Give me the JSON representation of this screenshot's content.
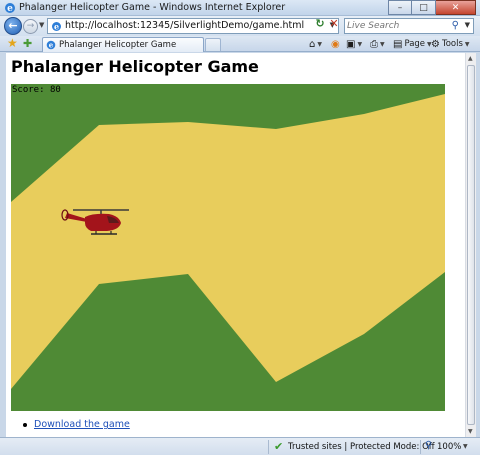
{
  "window": {
    "title": "Phalanger Helicopter Game - Windows Internet Explorer",
    "minimize_glyph": "–",
    "maximize_glyph": "□",
    "close_glyph": "✕"
  },
  "address_bar": {
    "url": "http://localhost:12345/SilverlightDemo/game.html",
    "search_placeholder": "Live Search"
  },
  "tab": {
    "label": "Phalanger Helicopter Game"
  },
  "command_bar": {
    "page_label": "Page",
    "tools_label": "Tools"
  },
  "page": {
    "heading": "Phalanger Helicopter Game",
    "score_label": "Score:",
    "score_value": "80",
    "download_link": "Download the game"
  },
  "status_bar": {
    "zone_text": "Trusted sites | Protected Mode: Off",
    "zoom": "100%"
  },
  "colors": {
    "terrain_green": "#4f8a35",
    "sky_yellow": "#e8cd5c",
    "helicopter_red": "#a3141b"
  },
  "icons": [
    "ie-icon",
    "back-arrow-icon",
    "forward-arrow-icon",
    "refresh-icon",
    "stop-icon",
    "search-icon",
    "favorites-star-icon",
    "add-favorites-icon",
    "home-icon",
    "feeds-icon",
    "print-icon",
    "page-icon",
    "tools-icon",
    "trusted-check-icon",
    "zoom-icon"
  ]
}
